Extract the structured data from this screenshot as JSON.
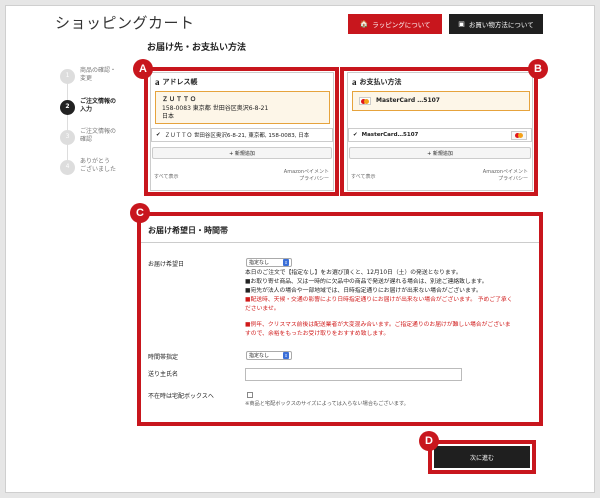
{
  "page": {
    "title": "ショッピングカート",
    "subtitle": "お届け先・お支払い方法"
  },
  "header": {
    "wrapping_label": "ラッピングについて",
    "payment_info_label": "お買い物方法について"
  },
  "steps": [
    {
      "num": "1",
      "line1": "商品の確認・",
      "line2": "変更"
    },
    {
      "num": "2",
      "line1": "ご注文情報の",
      "line2": "入力"
    },
    {
      "num": "3",
      "line1": "ご注文情報の",
      "line2": "確認"
    },
    {
      "num": "4",
      "line1": "ありがとう",
      "line2": "ございました"
    }
  ],
  "badges": {
    "a": "A",
    "b": "B",
    "c": "C",
    "d": "D"
  },
  "address_panel": {
    "logo": "a",
    "title": "アドレス帳",
    "selected": {
      "name": "ＺＵＴＴＯ",
      "address": "158-0083 東京都 世田谷区奥沢6-8-21",
      "country": "日本"
    },
    "option": "ＺＵＴＴＯ 世田谷区奥沢6-8-21, 東京都, 158-0083, 日本",
    "add_label": "+ 新規追加",
    "show_all": "すべて表示",
    "policy_line1": "Amazonペイメント",
    "policy_line2": "プライバシー"
  },
  "payment_panel": {
    "logo": "a",
    "title": "お支払い方法",
    "selected": "MasterCard …5107",
    "option": "MasterCard…5107",
    "add_label": "+ 新規追加",
    "show_all": "すべて表示",
    "policy_line1": "Amazonペイメント",
    "policy_line2": "プライバシー"
  },
  "delivery": {
    "title": "お届け希望日・時間帯",
    "date_label": "お届け希望日",
    "date_value": "指定なし",
    "note1": "本日のご注文で【指定なし】をお選び頂くと、12月10日（土）の発送となります。",
    "note2": "■お取り寄せ商品、又は一時的に欠品中の商品で発送が遅れる場合は、別途ご連絡致します。",
    "note3": "■宛先が法人の場合や一部地域では、日時指定通りにお届けが出来ない場合がございます。",
    "note4": "■配送時、天候・交通の影響により日時指定通りにお届けが出来ない場合がございます。 予めご了承く",
    "note4b": "ださいませ。",
    "note5": "■例年、クリスマス前後は配送業者が大変混み合います。ご指定通りのお届けが難しい場合がございま",
    "note5b": "すので、余裕をもったお受け取りをおすすめ致します。",
    "time_label": "時間帯指定",
    "time_value": "指定なし",
    "recipient_label": "送り主氏名",
    "recipient_value": "",
    "box_label": "不在時は宅配ボックスへ",
    "box_note": "※商品と宅配ボックスのサイズによっては入らない場合もございます。"
  },
  "next_button": "次に進む",
  "colors": {
    "accent_red": "#c8161d",
    "dark": "#1f1f1f",
    "highlight": "#e6a33c"
  },
  "icons": {
    "wrapping": "gift-icon",
    "payment_info": "cart-icon",
    "checkmark": "check-icon",
    "select_arrow": "updown-icon"
  }
}
